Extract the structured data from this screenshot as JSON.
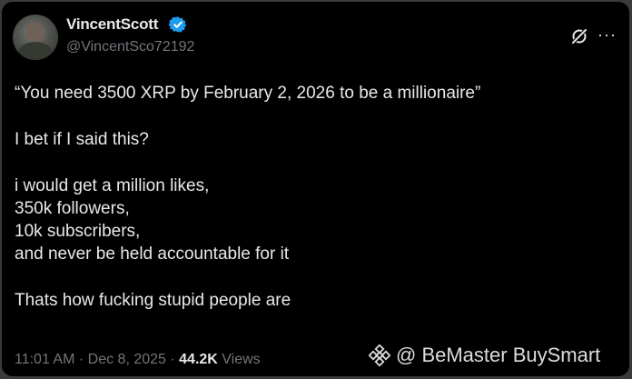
{
  "author": {
    "display_name": "VincentScott",
    "handle": "@VincentSco72192",
    "verified_color": "#1d9bf0"
  },
  "tweet": {
    "lines": [
      "“You need 3500 XRP by February 2, 2026 to be a millionaire”",
      "I bet if I said this?",
      "i would get a million likes,",
      "350k followers,",
      "10k subscribers,",
      "and never be held accountable for it",
      "Thats how fucking stupid people are"
    ]
  },
  "meta": {
    "time": "11:01 AM",
    "sep1": " · ",
    "date": "Dec 8, 2025",
    "sep2": " · ",
    "views_count": "44.2K",
    "views_label": " Views"
  },
  "icons": {
    "grok": "grok-icon",
    "more": "more-icon",
    "verified": "verified-badge-icon",
    "watermark_logo": "binance-logo-icon"
  },
  "watermark": {
    "text": "@ BeMaster BuySmart"
  }
}
